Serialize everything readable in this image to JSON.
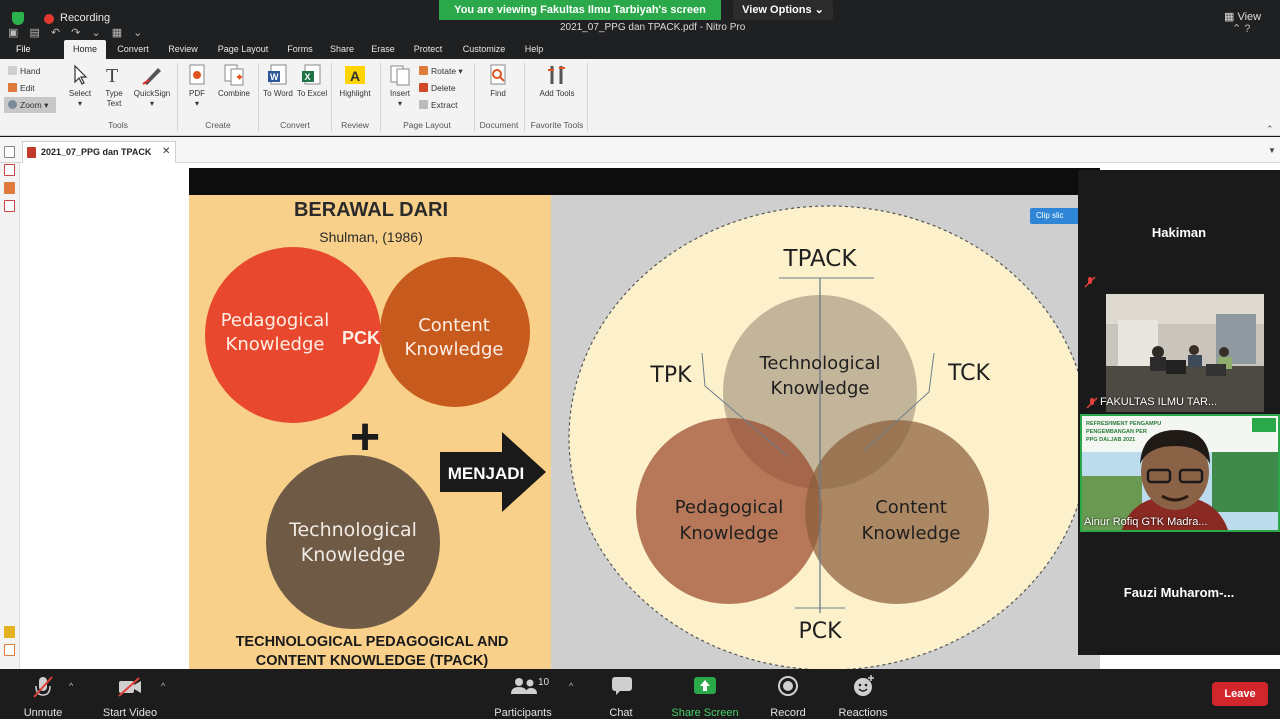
{
  "zoom": {
    "banner": "You are viewing Fakultas Ilmu Tarbiyah's screen",
    "view_options": "View Options ⌄",
    "view_btn": "View",
    "recording": "Recording",
    "participants_count": "10",
    "toolbar": {
      "unmute": "Unmute",
      "start_video": "Start Video",
      "participants": "Participants",
      "chat": "Chat",
      "share_screen": "Share Screen",
      "record": "Record",
      "reactions": "Reactions",
      "leave": "Leave"
    },
    "participants": [
      {
        "name": "Hakiman"
      },
      {
        "name": "FAKULTAS ILMU TAR..."
      },
      {
        "name": "Ainur Rofiq GTK Madra..."
      },
      {
        "name": "Fauzi  Muharom-..."
      }
    ],
    "share_preview_text": {
      "line1": "REFRESHMENT PENGAMPU",
      "line2": "PENGEMBANGAN PER",
      "line3": "PPG DALJAB 2021"
    }
  },
  "nitro": {
    "window_title": "2021_07_PPG dan TPACK.pdf - Nitro Pro",
    "file_tab": "File",
    "tabs": [
      "Home",
      "Convert",
      "Review",
      "Page Layout",
      "Forms",
      "Share",
      "Erase",
      "Protect",
      "Customize",
      "Help"
    ],
    "ribbon": {
      "hand": "Hand",
      "edit": "Edit",
      "zoom": "Zoom",
      "select": "Select",
      "type_text": "Type Text",
      "quicksign": "QuickSign",
      "pdf": "PDF",
      "combine": "Combine",
      "to_word": "To Word",
      "to_excel": "To Excel",
      "highlight": "Highlight",
      "insert": "Insert",
      "rotate": "Rotate",
      "delete": "Delete",
      "extract": "Extract",
      "find": "Find",
      "add_tools": "Add Tools",
      "groups": {
        "tools": "Tools",
        "create": "Create",
        "convert": "Convert",
        "review": "Review",
        "page_layout": "Page Layout",
        "document": "Document",
        "favorite_tools": "Favorite Tools"
      }
    },
    "doc_tab": "2021_07_PPG dan TPACK"
  },
  "slide": {
    "title": "BERAWAL DARI",
    "subtitle": "Shulman, (1986)",
    "left": {
      "pedagogical": [
        "Pedagogical",
        "Knowledge"
      ],
      "content": [
        "Content",
        "Knowledge"
      ],
      "pck": "PCK",
      "plus": "+",
      "technological": [
        "Technological",
        "Knowledge"
      ],
      "footer": [
        "TECHNOLOGICAL PEDAGOGICAL AND",
        "CONTENT KNOWLEDGE (TPACK)"
      ]
    },
    "arrow_label": "MENJADI",
    "clip_btn": "Clip slic",
    "right": {
      "tpack": "TPACK",
      "tpk": "TPK",
      "tck": "TCK",
      "pck": "PCK",
      "technological": [
        "Technological",
        "Knowledge"
      ],
      "pedagogical": [
        "Pedagogical",
        "Knowledge"
      ],
      "content": [
        "Content",
        "Knowledge"
      ]
    }
  },
  "colors": {
    "pedagogical_red": "#e8492e",
    "content_orange": "#c75a1d",
    "tech_brown": "#6f5a46",
    "slide_left_bg": "#f8d089",
    "zoom_green": "#2ba84a",
    "leave_red": "#d0262c"
  }
}
